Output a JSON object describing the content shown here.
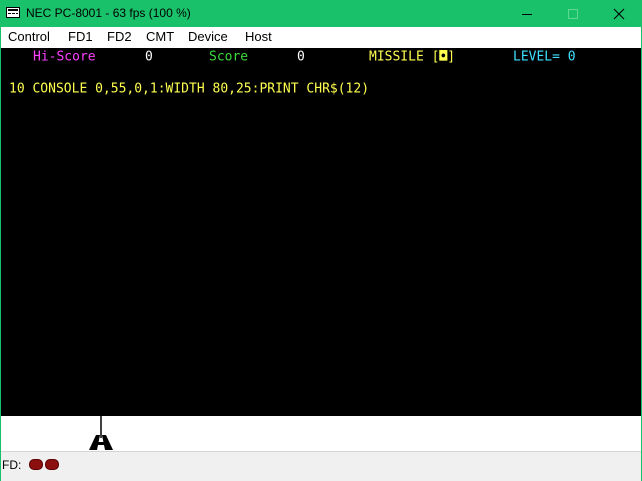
{
  "window": {
    "title": "NEC PC-8001 - 63 fps (100 %)",
    "titlebar_color": "#19c16a"
  },
  "menu": {
    "items": [
      "Control",
      "FD1",
      "FD2",
      "CMT",
      "Device",
      "Host"
    ]
  },
  "screen": {
    "hud": {
      "hiscore_label": "Hi-Score",
      "hiscore_value": "0",
      "score_label": "Score",
      "score_value": "0",
      "missile_label": "MISSILE [◘]",
      "level_label": "LEVEL= 0"
    },
    "basic_line": "10 CONSOLE 0,55,0,1:WIDTH 80,25:PRINT CHR$(12)",
    "colors": {
      "hiscore": "#ff40ff",
      "score_label": "#3cdc3c",
      "value": "#ffffff",
      "missile": "#ffff50",
      "level": "#40e0ff",
      "basic": "#ffff50",
      "background": "#000000",
      "ground": "#ffffff"
    }
  },
  "statusbar": {
    "fd_label": "FD:",
    "drive_led_color": "#8b0f0f"
  }
}
